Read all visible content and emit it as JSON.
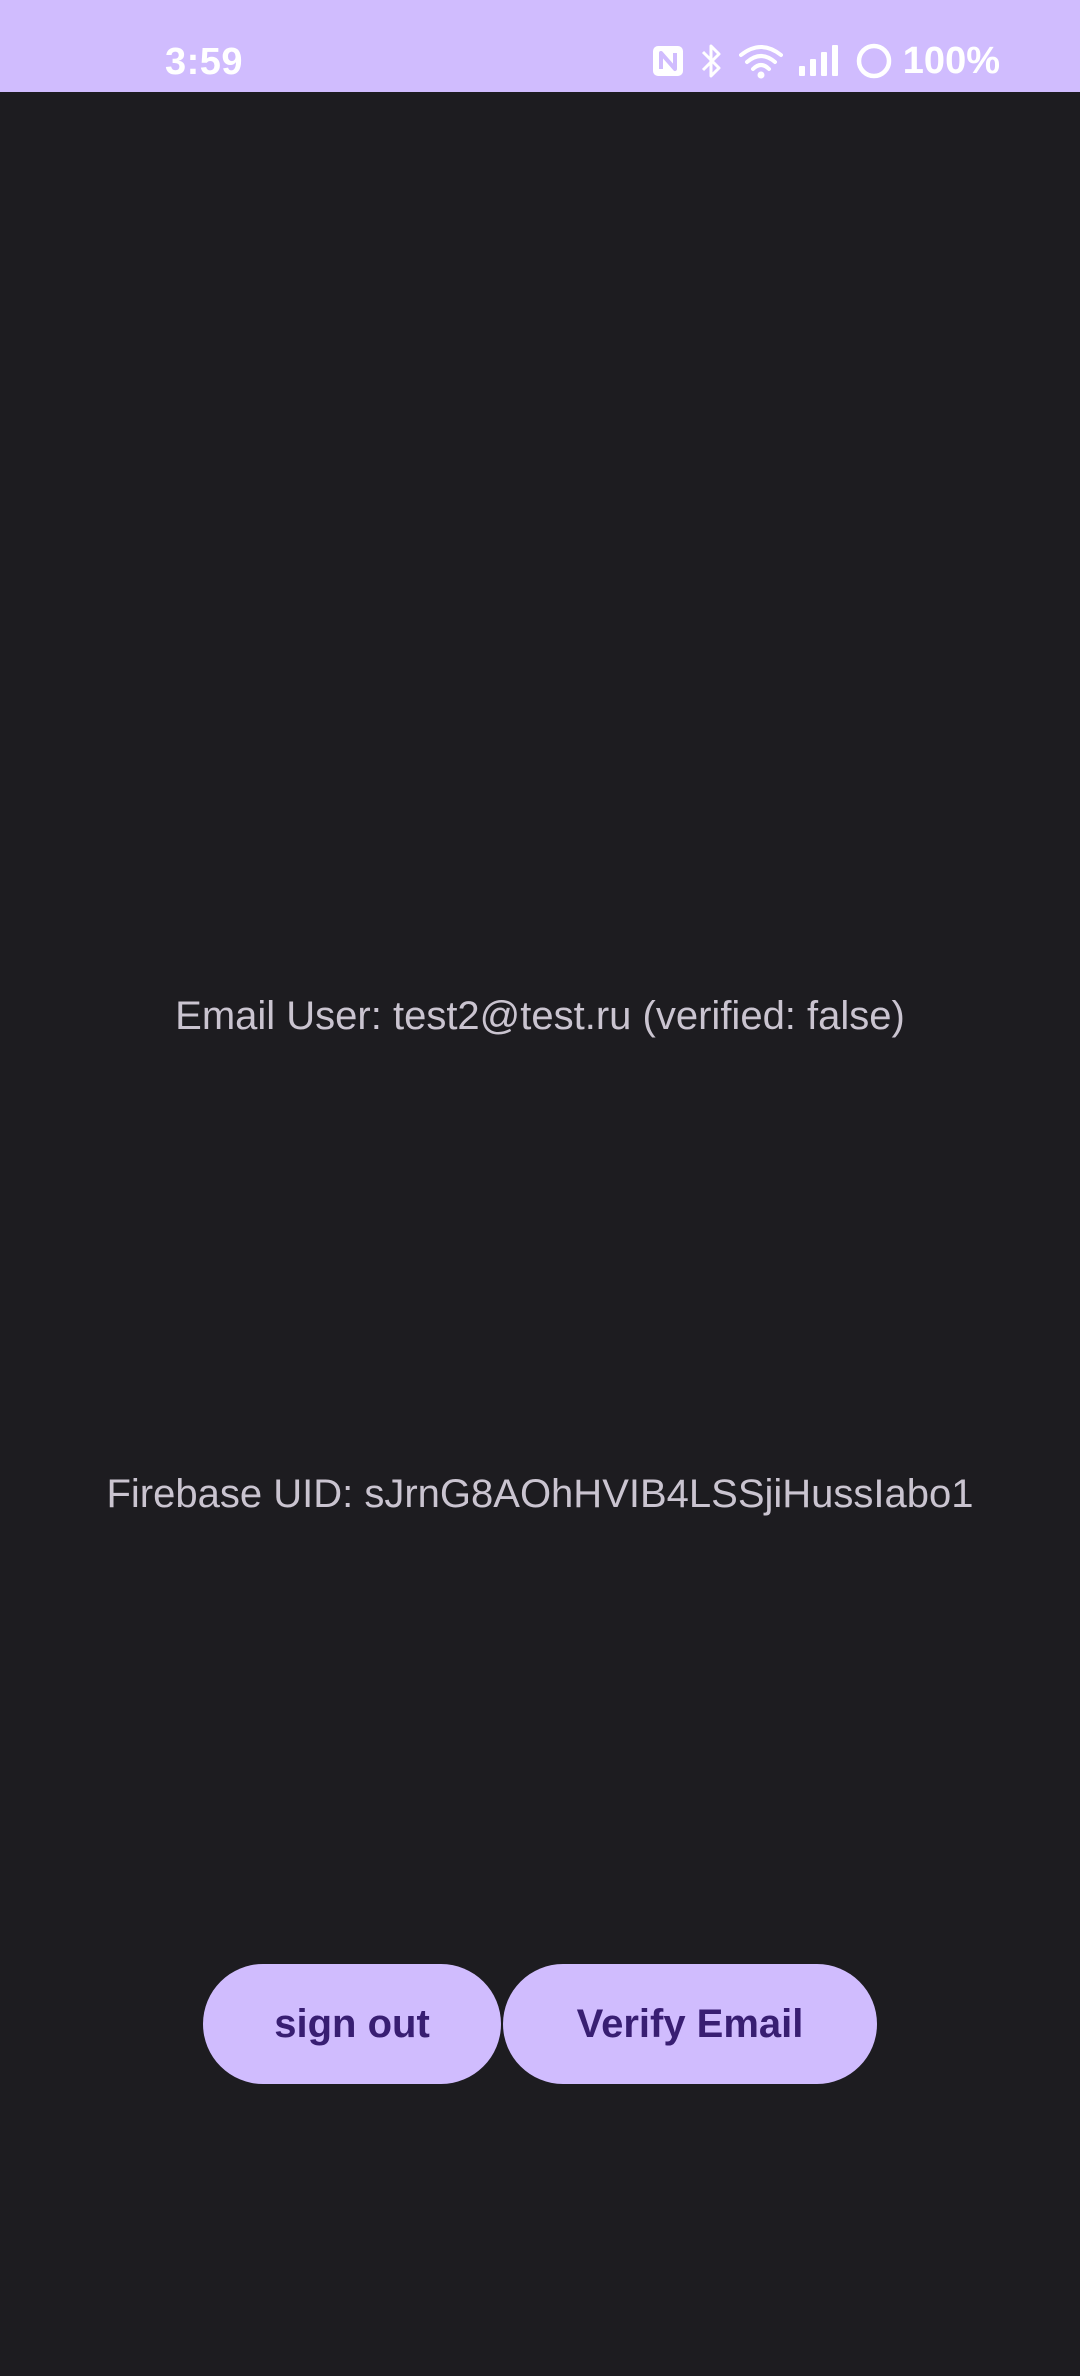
{
  "status_bar": {
    "time": "3:59",
    "battery": "100%",
    "icons": [
      "nfc-icon",
      "bluetooth-icon",
      "wifi-icon",
      "signal-icon",
      "battery-ring-icon"
    ],
    "background": "#d0bcfe"
  },
  "main": {
    "email_line": "Email User: test2@test.ru (verified: false)",
    "uid_line": "Firebase UID: sJrnG8AOhHVIB4LSSjiHussIabo1"
  },
  "actions": {
    "sign_out_label": "sign out",
    "verify_email_label": "Verify Email"
  },
  "colors": {
    "background": "#1d1c20",
    "accent": "#d0bcfe",
    "on_accent": "#381e72",
    "text": "#cac4d0"
  }
}
